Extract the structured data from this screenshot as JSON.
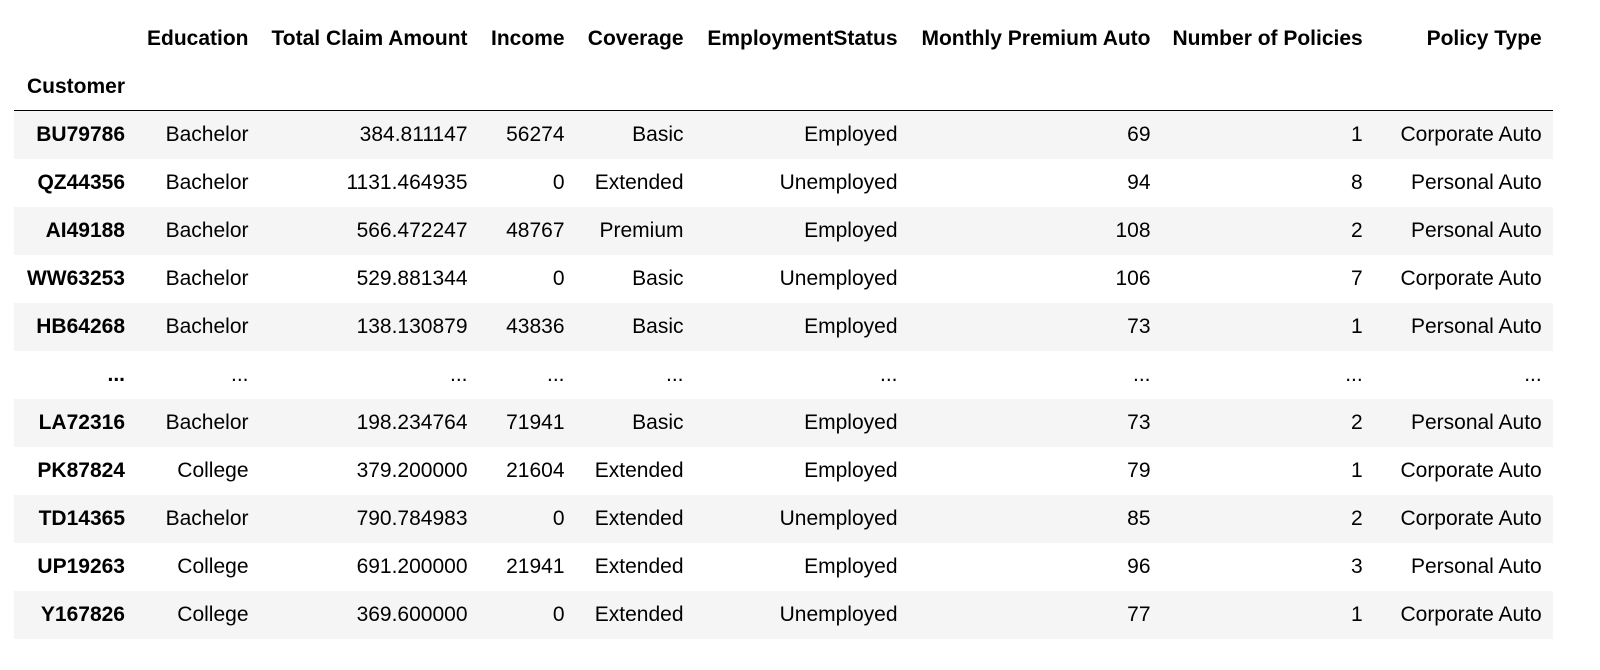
{
  "table": {
    "index_name": "Customer",
    "columns": [
      "Education",
      "Total Claim Amount",
      "Income",
      "Coverage",
      "EmploymentStatus",
      "Monthly Premium Auto",
      "Number of Policies",
      "Policy Type"
    ],
    "rows": [
      {
        "index": "BU79786",
        "cells": [
          "Bachelor",
          "384.811147",
          "56274",
          "Basic",
          "Employed",
          "69",
          "1",
          "Corporate Auto"
        ]
      },
      {
        "index": "QZ44356",
        "cells": [
          "Bachelor",
          "1131.464935",
          "0",
          "Extended",
          "Unemployed",
          "94",
          "8",
          "Personal Auto"
        ]
      },
      {
        "index": "AI49188",
        "cells": [
          "Bachelor",
          "566.472247",
          "48767",
          "Premium",
          "Employed",
          "108",
          "2",
          "Personal Auto"
        ]
      },
      {
        "index": "WW63253",
        "cells": [
          "Bachelor",
          "529.881344",
          "0",
          "Basic",
          "Unemployed",
          "106",
          "7",
          "Corporate Auto"
        ]
      },
      {
        "index": "HB64268",
        "cells": [
          "Bachelor",
          "138.130879",
          "43836",
          "Basic",
          "Employed",
          "73",
          "1",
          "Personal Auto"
        ]
      },
      {
        "index": "...",
        "cells": [
          "...",
          "...",
          "...",
          "...",
          "...",
          "...",
          "...",
          "..."
        ]
      },
      {
        "index": "LA72316",
        "cells": [
          "Bachelor",
          "198.234764",
          "71941",
          "Basic",
          "Employed",
          "73",
          "2",
          "Personal Auto"
        ]
      },
      {
        "index": "PK87824",
        "cells": [
          "College",
          "379.200000",
          "21604",
          "Extended",
          "Employed",
          "79",
          "1",
          "Corporate Auto"
        ]
      },
      {
        "index": "TD14365",
        "cells": [
          "Bachelor",
          "790.784983",
          "0",
          "Extended",
          "Unemployed",
          "85",
          "2",
          "Corporate Auto"
        ]
      },
      {
        "index": "UP19263",
        "cells": [
          "College",
          "691.200000",
          "21941",
          "Extended",
          "Employed",
          "96",
          "3",
          "Personal Auto"
        ]
      },
      {
        "index": "Y167826",
        "cells": [
          "College",
          "369.600000",
          "0",
          "Extended",
          "Unemployed",
          "77",
          "1",
          "Corporate Auto"
        ]
      }
    ]
  }
}
